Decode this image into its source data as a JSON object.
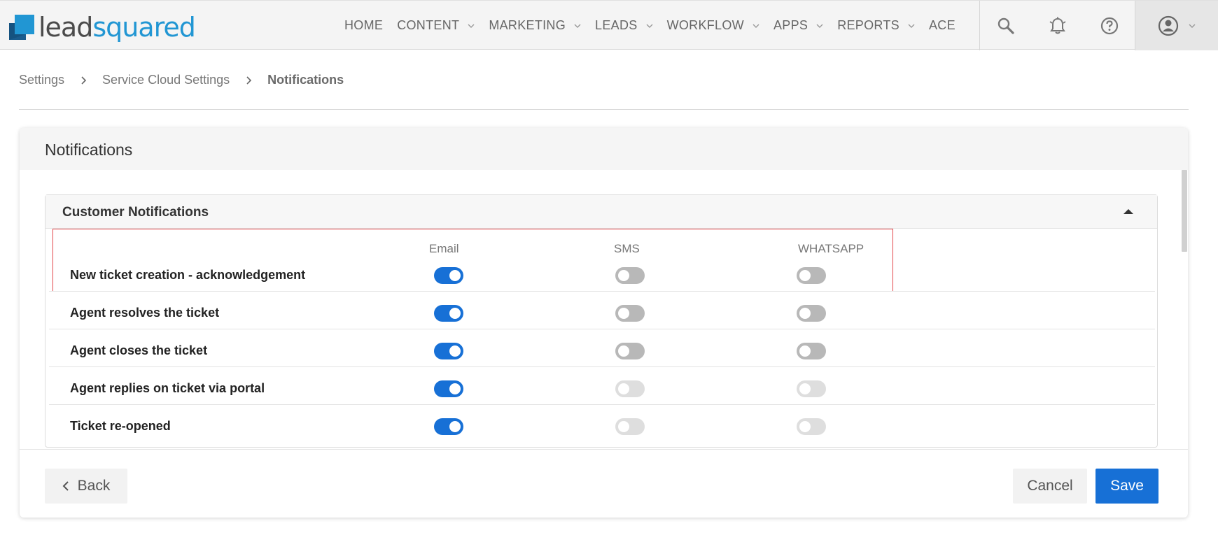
{
  "brand": {
    "name_part1": "lead",
    "name_part2": "squared",
    "accent": "#2196d3",
    "icon": "leadsquared-logo-mark"
  },
  "nav": {
    "items": [
      {
        "label": "HOME",
        "has_dropdown": false
      },
      {
        "label": "CONTENT",
        "has_dropdown": true
      },
      {
        "label": "MARKETING",
        "has_dropdown": true
      },
      {
        "label": "LEADS",
        "has_dropdown": true
      },
      {
        "label": "WORKFLOW",
        "has_dropdown": true
      },
      {
        "label": "APPS",
        "has_dropdown": true
      },
      {
        "label": "REPORTS",
        "has_dropdown": true
      },
      {
        "label": "ACE",
        "has_dropdown": false
      }
    ],
    "icons": [
      "search-icon",
      "bell-icon",
      "help-icon",
      "user-icon"
    ]
  },
  "breadcrumb": {
    "items": [
      "Settings",
      "Service Cloud Settings"
    ],
    "current": "Notifications"
  },
  "card": {
    "title": "Notifications"
  },
  "panel": {
    "title": "Customer Notifications",
    "columns": [
      "Email",
      "SMS",
      "WHATSAPP"
    ],
    "rows": [
      {
        "label": "New ticket creation - acknowledgement",
        "email": "on",
        "sms": "off",
        "whatsapp": "off"
      },
      {
        "label": "Agent resolves the ticket",
        "email": "on",
        "sms": "off",
        "whatsapp": "off"
      },
      {
        "label": "Agent closes the ticket",
        "email": "on",
        "sms": "off",
        "whatsapp": "off"
      },
      {
        "label": "Agent replies on ticket via portal",
        "email": "on",
        "sms": "disabled",
        "whatsapp": "disabled"
      },
      {
        "label": "Ticket re-opened",
        "email": "on",
        "sms": "disabled",
        "whatsapp": "disabled"
      }
    ]
  },
  "footer": {
    "back_label": "Back",
    "cancel_label": "Cancel",
    "save_label": "Save"
  },
  "colors": {
    "primary": "#1770d6",
    "toggle_off": "#b8b8b8",
    "toggle_disabled": "#dedede",
    "highlight_border": "#e2474a"
  }
}
